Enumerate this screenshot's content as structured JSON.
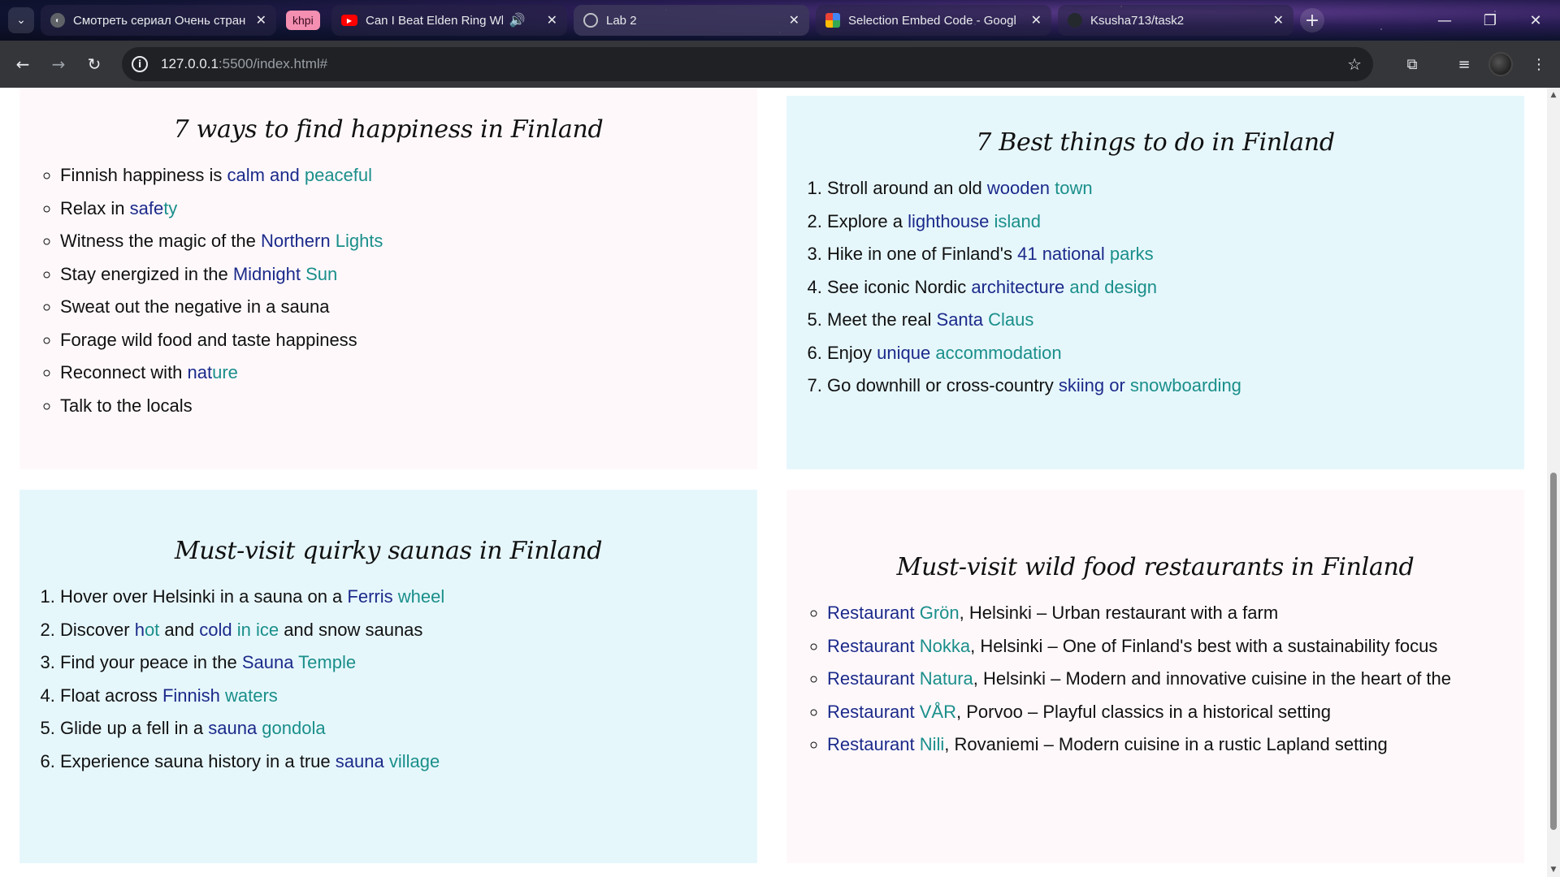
{
  "browser": {
    "tabs": [
      {
        "title": "Смотреть сериал Очень стран",
        "favicon": "mask-icon"
      },
      {
        "title": "Can I Beat Elden Ring While",
        "favicon": "youtube-icon"
      },
      {
        "title": "Lab 2",
        "favicon": "globe-icon"
      },
      {
        "title": "Selection Embed Code - Googl",
        "favicon": "google-icon"
      },
      {
        "title": "Ksusha713/task2",
        "favicon": "github-icon"
      }
    ],
    "group_label": "khpi",
    "url_host": "127.0.0.1",
    "url_path": ":5500/index.html#"
  },
  "cards": {
    "happiness": {
      "title": "7 ways to find happiness in Finland",
      "items": [
        {
          "t": "Finnish happiness is ",
          "l1": "calm and",
          "l2": " peaceful",
          "t2": ""
        },
        {
          "t": "Relax in ",
          "l1": "safe",
          "l2": "ty",
          "t2": ""
        },
        {
          "t": "Witness the magic of the ",
          "l1": "Northern",
          "l2": " Lights",
          "t2": ""
        },
        {
          "t": "Stay energized in the ",
          "l1": "Midnight",
          "l2": " Sun",
          "t2": ""
        },
        {
          "t": "Sweat out the negative in a sauna",
          "l1": "",
          "l2": "",
          "t2": ""
        },
        {
          "t": "Forage wild food and taste happiness",
          "l1": "",
          "l2": "",
          "t2": ""
        },
        {
          "t": "Reconnect with ",
          "l1": "nat",
          "l2": "ure",
          "t2": ""
        },
        {
          "t": "Talk to the locals",
          "l1": "",
          "l2": "",
          "t2": ""
        }
      ]
    },
    "best_things": {
      "title": "7 Best things to do in Finland",
      "items": [
        {
          "t": "Stroll around an old ",
          "l1": "wooden",
          "l2": " town",
          "t2": ""
        },
        {
          "t": "Explore a ",
          "l1": "lighthouse",
          "l2": " island",
          "t2": ""
        },
        {
          "t": "Hike in one of Finland's ",
          "l1": "41 national",
          "l2": " parks",
          "t2": ""
        },
        {
          "t": "See iconic Nordic ",
          "l1": "architecture",
          "l2": " and design",
          "t2": ""
        },
        {
          "t": "Meet the real ",
          "l1": "Santa",
          "l2": " Claus",
          "t2": ""
        },
        {
          "t": "Enjoy ",
          "l1": "unique",
          "l2": " accommodation",
          "t2": ""
        },
        {
          "t": "Go downhill or cross-country ",
          "l1": "skiing or",
          "l2": " snowboarding",
          "t2": ""
        }
      ]
    },
    "saunas": {
      "title": "Must-visit quirky saunas in Finland",
      "items": [
        {
          "t": "Hover over Helsinki in a sauna on a ",
          "l1": "Ferris",
          "l2": " wheel",
          "t2": ""
        },
        {
          "t": "Discover ",
          "l1": "h",
          "l2": "ot",
          "t2": " and ",
          "l3": "cold",
          "l4": " in ice",
          "t3": " and snow saunas"
        },
        {
          "t": "Find your peace in the ",
          "l1": "Sauna",
          "l2": " Temple",
          "t2": ""
        },
        {
          "t": "Float across ",
          "l1": "Finnish",
          "l2": " waters",
          "t2": ""
        },
        {
          "t": "Glide up a fell in a ",
          "l1": "sauna",
          "l2": " gondola",
          "t2": ""
        },
        {
          "t": "Experience sauna history in a true ",
          "l1": "sauna",
          "l2": " village",
          "t2": ""
        }
      ]
    },
    "restaurants": {
      "title": "Must-visit wild food restaurants in Finland",
      "items": [
        {
          "t": "",
          "l1": "Restaurant",
          "l2": " Grön",
          "t2": ", Helsinki – Urban restaurant with a farm"
        },
        {
          "t": "",
          "l1": "Restaurant",
          "l2": " Nokka",
          "t2": ", Helsinki – One of Finland's best with a sustainability focus"
        },
        {
          "t": "",
          "l1": "Restaurant",
          "l2": " Natura",
          "t2": ", Helsinki – Modern and innovative cuisine in the heart of the"
        },
        {
          "t": "",
          "l1": "Restaurant",
          "l2": " VÅR",
          "t2": ", Porvoo – Playful classics in a historical setting"
        },
        {
          "t": "",
          "l1": "Restaurant",
          "l2": " Nili",
          "t2": ", Rovaniemi – Modern cuisine in a rustic Lapland setting"
        }
      ]
    }
  }
}
